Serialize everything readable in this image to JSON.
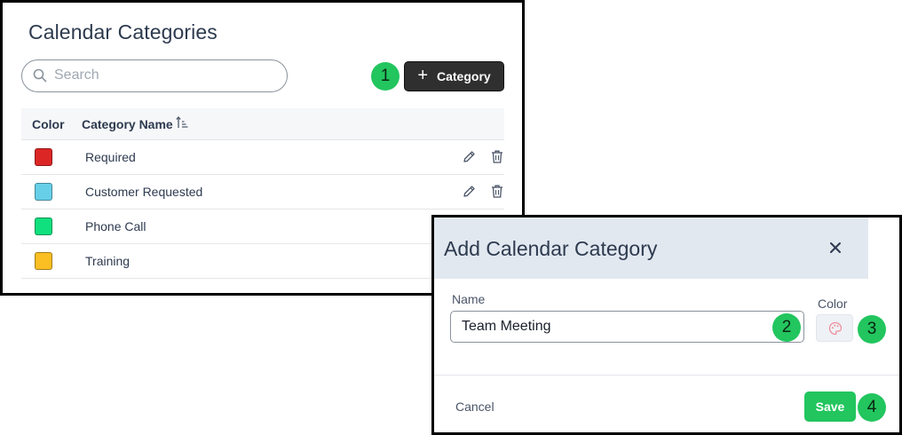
{
  "categories_panel": {
    "title": "Calendar Categories",
    "search": {
      "placeholder": "Search",
      "value": ""
    },
    "add_button_label": "Category",
    "table": {
      "headers": {
        "color": "Color",
        "name": "Category Name"
      },
      "rows": [
        {
          "name": "Required",
          "color": "#dc2626",
          "actions": true
        },
        {
          "name": "Customer Requested",
          "color": "#67cfe8",
          "actions": true
        },
        {
          "name": "Phone Call",
          "color": "#10e07e",
          "actions": false
        },
        {
          "name": "Training",
          "color": "#fbbf24",
          "actions": false
        }
      ]
    }
  },
  "dialog": {
    "title": "Add Calendar Category",
    "name_label": "Name",
    "name_value": "Team Meeting",
    "color_label": "Color",
    "cancel_label": "Cancel",
    "save_label": "Save"
  },
  "step_badges": [
    "1",
    "2",
    "3",
    "4"
  ],
  "colors": {
    "accent_green": "#22c55e",
    "dark_button": "#2f2f2f",
    "dialog_header_bg": "#e2e8f0"
  }
}
